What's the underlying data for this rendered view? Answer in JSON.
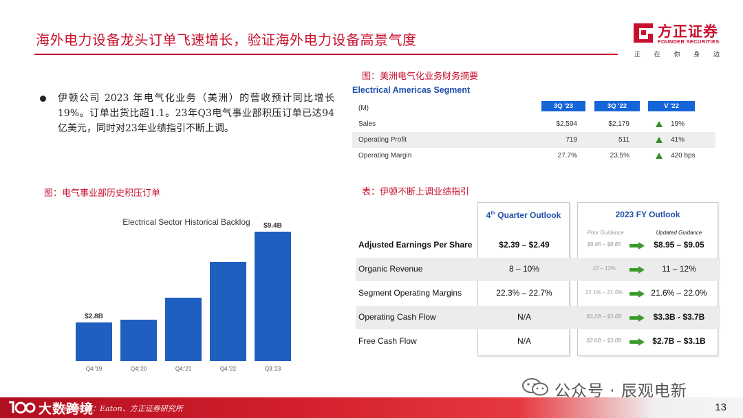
{
  "header": {
    "title": "海外电力设备龙头订单飞速增长，验证海外电力设备高景气度",
    "logo_cn": "方正证券",
    "logo_en": "FOUNDER SECURITIES",
    "slogan": [
      "正",
      "在",
      "你",
      "身",
      "边"
    ],
    "brand_color": "#c8102e"
  },
  "bullet": {
    "text": "伊顿公司 2023 年电气化业务（美洲）的营收预计同比增长 19%。订单出货比超1.1。23年Q3电气事业部积压订单已达94亿美元，同时对23年业绩指引不断上调。"
  },
  "fin_caption": "图：美洲电气化业务财务摘要",
  "financials": {
    "title": "Electrical Americas Segment",
    "unit": "(M)",
    "columns": [
      "3Q '23",
      "3Q '22",
      "V '22"
    ],
    "rows": [
      {
        "label": "Sales",
        "q23": "$2,594",
        "q22": "$2,179",
        "var": "19%"
      },
      {
        "label": "Operating Profit",
        "q23": "719",
        "q22": "511",
        "var": "41%"
      },
      {
        "label": "Operating Margin",
        "q23": "27.7%",
        "q22": "23.5%",
        "var": "420 bps"
      }
    ],
    "header_color": "#1565d8",
    "up_color": "#3a8a2e"
  },
  "backlog_caption": "图：电气事业部历史积压订单",
  "chart_data": {
    "type": "bar",
    "title": "Electrical Sector Historical Backlog",
    "categories": [
      "Q4:'19",
      "Q4:'20",
      "Q4:'21",
      "Q4:'22",
      "Q3:'23"
    ],
    "values": [
      2.8,
      3.0,
      4.6,
      7.2,
      9.4
    ],
    "data_labels": [
      "$2.8B",
      "",
      "",
      "",
      "$9.4B"
    ],
    "unit": "$B",
    "ylim": [
      0,
      9.4
    ],
    "grid": false,
    "bar_color": "#1f5fbf"
  },
  "outlook_caption": "表：伊顿不断上调业绩指引",
  "outlook": {
    "q4_header_prefix": "4",
    "q4_header_sup": "th",
    "q4_header_suffix": " Quarter Outlook",
    "fy_header": "2023 FY Outlook",
    "prior_label": "Prior Guidance",
    "updated_label": "Updated Guidance",
    "rows": [
      {
        "label": "Adjusted Earnings Per Share",
        "q4": "$2.39 – $2.49",
        "prior": "$8.65 – $8.85",
        "updated": "$8.95 – $9.05"
      },
      {
        "label": "Organic Revenue",
        "q4": "8 – 10%",
        "prior": "10 – 12%",
        "updated": "11 – 12%"
      },
      {
        "label": "Segment Operating Margins",
        "q4": "22.3% – 22.7%",
        "prior": "21.1% – 21.5%",
        "updated": "21.6% – 22.0%"
      },
      {
        "label": "Operating Cash Flow",
        "q4": "N/A",
        "prior": "$3.2B – $3.6B",
        "updated": "$3.3B - $3.7B"
      },
      {
        "label": "Free Cash Flow",
        "q4": "N/A",
        "prior": "$2.6B – $3.0B",
        "updated": "$2.7B – $3.1B"
      }
    ],
    "arrow_color": "#3a9a2a",
    "header_color": "#1f4fa8"
  },
  "watermark": {
    "text": "公众号 · 辰观电新"
  },
  "footer": {
    "source": "资料来源：Eaton、方正证券研究所",
    "logo_text": "大数跨境",
    "page_number": "13"
  }
}
